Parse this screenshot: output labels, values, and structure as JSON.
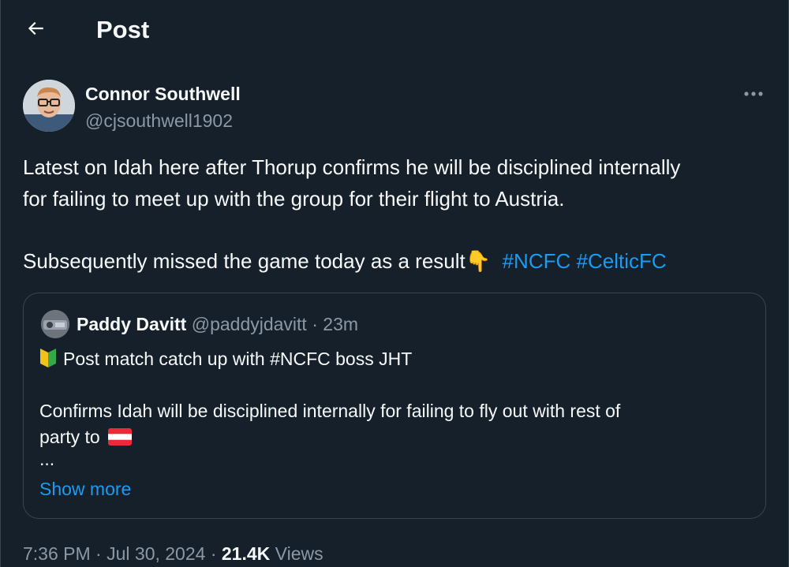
{
  "header": {
    "back_icon": "arrow-left-icon",
    "title": "Post"
  },
  "author": {
    "name": "Connor Southwell",
    "handle": "@cjsouthwell1902",
    "more_icon": "more-dots-icon"
  },
  "tweet": {
    "paragraph1_line1": "Latest on Idah here after Thorup confirms he will be disciplined internally",
    "paragraph1_line2": "for failing to meet up with the group for their flight to Austria.",
    "paragraph2_text": "Subsequently missed the game today as a result",
    "emoji": "👇",
    "hashtags": [
      "#NCFC",
      "#CelticFC"
    ]
  },
  "quote": {
    "name": "Paddy Davitt",
    "handle": "@paddyjdavitt",
    "separator": "·",
    "time": "23m",
    "line1_prefix_icon": "japanese-beginner-symbol-icon",
    "line1_text": "Post match catch up with #NCFC boss JHT",
    "line2": "Confirms Idah will be disciplined internally for failing to fly out with rest of",
    "line3_text": "party to",
    "line3_flag_icon": "austria-flag-icon",
    "ellipsis": "...",
    "show_more": "Show more"
  },
  "meta": {
    "time": "7:36 PM",
    "sep1": "·",
    "date": "Jul 30, 2024",
    "sep2": "·",
    "views_count": "21.4K",
    "views_label": "Views"
  },
  "colors": {
    "background": "#15202b",
    "border": "#38444d",
    "text": "#f7f9f9",
    "secondary_text": "#8b98a5",
    "accent": "#1d9bf0"
  }
}
